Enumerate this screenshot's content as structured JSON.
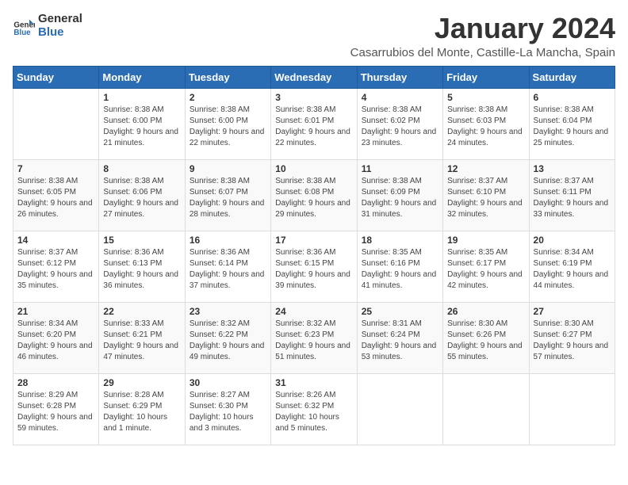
{
  "header": {
    "logo_general": "General",
    "logo_blue": "Blue",
    "month_title": "January 2024",
    "location": "Casarrubios del Monte, Castille-La Mancha, Spain"
  },
  "days_of_week": [
    "Sunday",
    "Monday",
    "Tuesday",
    "Wednesday",
    "Thursday",
    "Friday",
    "Saturday"
  ],
  "weeks": [
    [
      {
        "day": "",
        "sunrise": "",
        "sunset": "",
        "daylight": ""
      },
      {
        "day": "1",
        "sunrise": "Sunrise: 8:38 AM",
        "sunset": "Sunset: 6:00 PM",
        "daylight": "Daylight: 9 hours and 21 minutes."
      },
      {
        "day": "2",
        "sunrise": "Sunrise: 8:38 AM",
        "sunset": "Sunset: 6:00 PM",
        "daylight": "Daylight: 9 hours and 22 minutes."
      },
      {
        "day": "3",
        "sunrise": "Sunrise: 8:38 AM",
        "sunset": "Sunset: 6:01 PM",
        "daylight": "Daylight: 9 hours and 22 minutes."
      },
      {
        "day": "4",
        "sunrise": "Sunrise: 8:38 AM",
        "sunset": "Sunset: 6:02 PM",
        "daylight": "Daylight: 9 hours and 23 minutes."
      },
      {
        "day": "5",
        "sunrise": "Sunrise: 8:38 AM",
        "sunset": "Sunset: 6:03 PM",
        "daylight": "Daylight: 9 hours and 24 minutes."
      },
      {
        "day": "6",
        "sunrise": "Sunrise: 8:38 AM",
        "sunset": "Sunset: 6:04 PM",
        "daylight": "Daylight: 9 hours and 25 minutes."
      }
    ],
    [
      {
        "day": "7",
        "sunrise": "Sunrise: 8:38 AM",
        "sunset": "Sunset: 6:05 PM",
        "daylight": "Daylight: 9 hours and 26 minutes."
      },
      {
        "day": "8",
        "sunrise": "Sunrise: 8:38 AM",
        "sunset": "Sunset: 6:06 PM",
        "daylight": "Daylight: 9 hours and 27 minutes."
      },
      {
        "day": "9",
        "sunrise": "Sunrise: 8:38 AM",
        "sunset": "Sunset: 6:07 PM",
        "daylight": "Daylight: 9 hours and 28 minutes."
      },
      {
        "day": "10",
        "sunrise": "Sunrise: 8:38 AM",
        "sunset": "Sunset: 6:08 PM",
        "daylight": "Daylight: 9 hours and 29 minutes."
      },
      {
        "day": "11",
        "sunrise": "Sunrise: 8:38 AM",
        "sunset": "Sunset: 6:09 PM",
        "daylight": "Daylight: 9 hours and 31 minutes."
      },
      {
        "day": "12",
        "sunrise": "Sunrise: 8:37 AM",
        "sunset": "Sunset: 6:10 PM",
        "daylight": "Daylight: 9 hours and 32 minutes."
      },
      {
        "day": "13",
        "sunrise": "Sunrise: 8:37 AM",
        "sunset": "Sunset: 6:11 PM",
        "daylight": "Daylight: 9 hours and 33 minutes."
      }
    ],
    [
      {
        "day": "14",
        "sunrise": "Sunrise: 8:37 AM",
        "sunset": "Sunset: 6:12 PM",
        "daylight": "Daylight: 9 hours and 35 minutes."
      },
      {
        "day": "15",
        "sunrise": "Sunrise: 8:36 AM",
        "sunset": "Sunset: 6:13 PM",
        "daylight": "Daylight: 9 hours and 36 minutes."
      },
      {
        "day": "16",
        "sunrise": "Sunrise: 8:36 AM",
        "sunset": "Sunset: 6:14 PM",
        "daylight": "Daylight: 9 hours and 37 minutes."
      },
      {
        "day": "17",
        "sunrise": "Sunrise: 8:36 AM",
        "sunset": "Sunset: 6:15 PM",
        "daylight": "Daylight: 9 hours and 39 minutes."
      },
      {
        "day": "18",
        "sunrise": "Sunrise: 8:35 AM",
        "sunset": "Sunset: 6:16 PM",
        "daylight": "Daylight: 9 hours and 41 minutes."
      },
      {
        "day": "19",
        "sunrise": "Sunrise: 8:35 AM",
        "sunset": "Sunset: 6:17 PM",
        "daylight": "Daylight: 9 hours and 42 minutes."
      },
      {
        "day": "20",
        "sunrise": "Sunrise: 8:34 AM",
        "sunset": "Sunset: 6:19 PM",
        "daylight": "Daylight: 9 hours and 44 minutes."
      }
    ],
    [
      {
        "day": "21",
        "sunrise": "Sunrise: 8:34 AM",
        "sunset": "Sunset: 6:20 PM",
        "daylight": "Daylight: 9 hours and 46 minutes."
      },
      {
        "day": "22",
        "sunrise": "Sunrise: 8:33 AM",
        "sunset": "Sunset: 6:21 PM",
        "daylight": "Daylight: 9 hours and 47 minutes."
      },
      {
        "day": "23",
        "sunrise": "Sunrise: 8:32 AM",
        "sunset": "Sunset: 6:22 PM",
        "daylight": "Daylight: 9 hours and 49 minutes."
      },
      {
        "day": "24",
        "sunrise": "Sunrise: 8:32 AM",
        "sunset": "Sunset: 6:23 PM",
        "daylight": "Daylight: 9 hours and 51 minutes."
      },
      {
        "day": "25",
        "sunrise": "Sunrise: 8:31 AM",
        "sunset": "Sunset: 6:24 PM",
        "daylight": "Daylight: 9 hours and 53 minutes."
      },
      {
        "day": "26",
        "sunrise": "Sunrise: 8:30 AM",
        "sunset": "Sunset: 6:26 PM",
        "daylight": "Daylight: 9 hours and 55 minutes."
      },
      {
        "day": "27",
        "sunrise": "Sunrise: 8:30 AM",
        "sunset": "Sunset: 6:27 PM",
        "daylight": "Daylight: 9 hours and 57 minutes."
      }
    ],
    [
      {
        "day": "28",
        "sunrise": "Sunrise: 8:29 AM",
        "sunset": "Sunset: 6:28 PM",
        "daylight": "Daylight: 9 hours and 59 minutes."
      },
      {
        "day": "29",
        "sunrise": "Sunrise: 8:28 AM",
        "sunset": "Sunset: 6:29 PM",
        "daylight": "Daylight: 10 hours and 1 minute."
      },
      {
        "day": "30",
        "sunrise": "Sunrise: 8:27 AM",
        "sunset": "Sunset: 6:30 PM",
        "daylight": "Daylight: 10 hours and 3 minutes."
      },
      {
        "day": "31",
        "sunrise": "Sunrise: 8:26 AM",
        "sunset": "Sunset: 6:32 PM",
        "daylight": "Daylight: 10 hours and 5 minutes."
      },
      {
        "day": "",
        "sunrise": "",
        "sunset": "",
        "daylight": ""
      },
      {
        "day": "",
        "sunrise": "",
        "sunset": "",
        "daylight": ""
      },
      {
        "day": "",
        "sunrise": "",
        "sunset": "",
        "daylight": ""
      }
    ]
  ]
}
